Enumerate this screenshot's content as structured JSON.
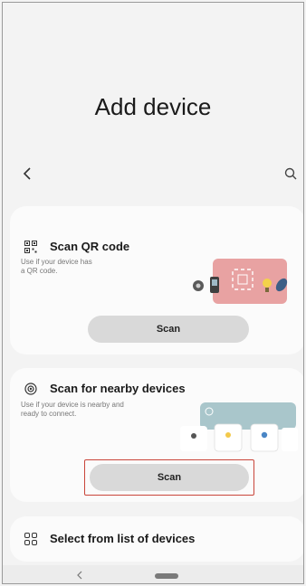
{
  "header": {
    "title": "Add device"
  },
  "topbar": {
    "back_icon": "chevron-left-icon",
    "search_icon": "search-icon"
  },
  "cards": [
    {
      "icon": "qr-code-icon",
      "title": "Scan QR code",
      "description": "Use if your device has a QR code.",
      "button_label": "Scan",
      "illustration": "devices-qr-illustration"
    },
    {
      "icon": "nearby-scan-icon",
      "title": "Scan for nearby devices",
      "description": "Use if your device is nearby and ready to connect.",
      "button_label": "Scan",
      "illustration": "nearby-devices-illustration"
    },
    {
      "icon": "grid-list-icon",
      "title": "Select from list of devices"
    }
  ],
  "colors": {
    "background": "#f3f3f3",
    "card": "#fbfbfb",
    "button": "#d9d9d9",
    "highlight": "#c9453a",
    "qr_panel": "#e8a2a2",
    "nearby_panel": "#a9c6cb"
  }
}
